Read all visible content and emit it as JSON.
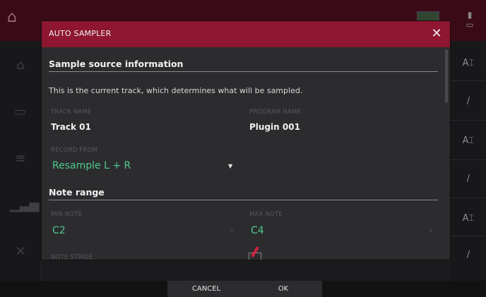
{
  "dialog": {
    "title": "AUTO SAMPLER",
    "close_icon": "close-icon"
  },
  "source_section": {
    "heading": "Sample source information",
    "description": "This is the current track, which determines what will be sampled.",
    "track_name_label": "TRACK NAME",
    "track_name_value": "Track 01",
    "program_name_label": "PROGRAM NAME",
    "program_name_value": "Plugin 001",
    "record_from_label": "RECORD FROM",
    "record_from_value": "Resample L + R"
  },
  "note_range": {
    "heading": "Note range",
    "min_note_label": "MIN NOTE",
    "min_note_value": "C2",
    "max_note_label": "MAX NOTE",
    "max_note_value": "C4",
    "note_stride_label": "NOTE STRIDE"
  },
  "footer": {
    "cancel_label": "CANCEL",
    "ok_label": "OK"
  },
  "colors": {
    "header": "#8e1630",
    "accent": "#4fc98e",
    "background": "#2c2c2f"
  }
}
